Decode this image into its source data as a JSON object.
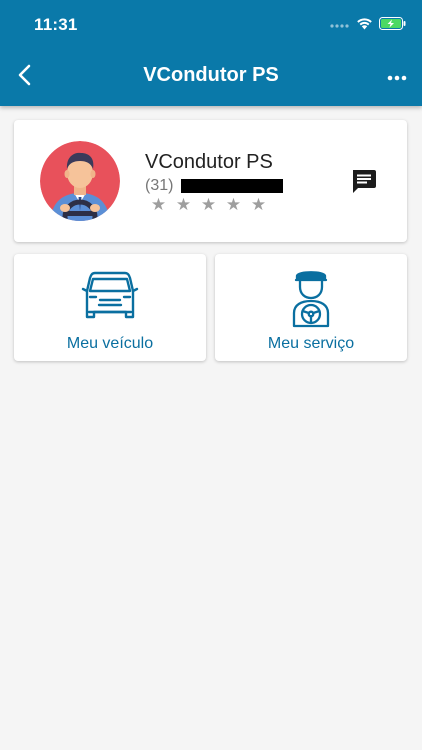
{
  "status_bar": {
    "time": "11:31"
  },
  "nav": {
    "title": "VCondutor PS",
    "back_icon": "chevron-left-icon",
    "more_icon": "more-horizontal-icon"
  },
  "profile": {
    "name": "VCondutor PS",
    "phone_prefix": "(31)",
    "rating_stars": [
      "★",
      "★",
      "★",
      "★",
      "★"
    ],
    "rating_value": 0,
    "avatar_icon": "driver-avatar-icon",
    "chat_icon": "chat-icon"
  },
  "tiles": [
    {
      "label": "Meu veículo",
      "icon": "car-icon"
    },
    {
      "label": "Meu serviço",
      "icon": "driver-icon"
    }
  ],
  "colors": {
    "header": "#0a79a9",
    "background": "#f5f5f5",
    "accent": "#0a6fa0",
    "avatar_bg": "#e8515b",
    "star": "#9e9e9e"
  }
}
